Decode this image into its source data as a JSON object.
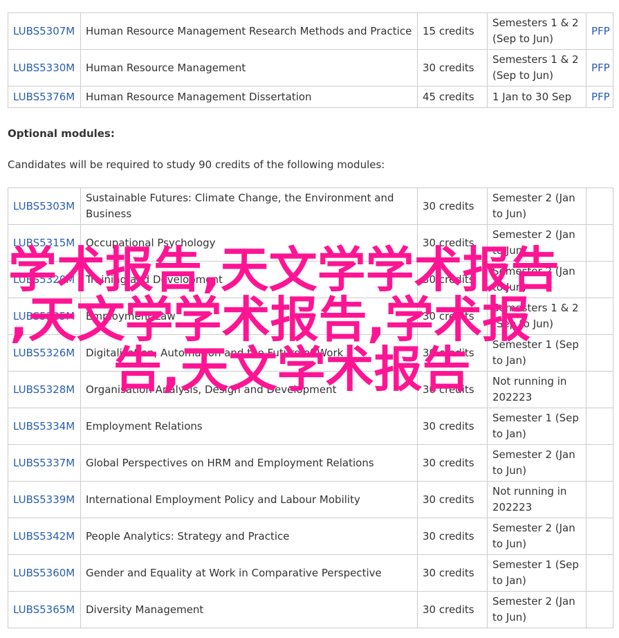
{
  "core_modules": [
    {
      "code": "LUBS5307M",
      "name": "Human Resource Management Research Methods and Practice",
      "credits": "15 credits",
      "semester_line1": "Semesters 1 & 2",
      "semester_line2": "(Sep to Jun)",
      "pfp": "PFP"
    },
    {
      "code": "LUBS5330M",
      "name": "Human Resource Management",
      "credits": "30 credits",
      "semester_line1": "Semesters 1 & 2",
      "semester_line2": "(Sep to Jun)",
      "pfp": "PFP"
    },
    {
      "code": "LUBS5376M",
      "name": "Human Resource Management Dissertation",
      "credits": "45 credits",
      "semester_line1": "1 Jan to 30 Sep",
      "semester_line2": "",
      "pfp": "PFP"
    }
  ],
  "optional_heading": "Optional modules:",
  "optional_intro": "Candidates will be required to study 90 credits of the following modules:",
  "optional_modules": [
    {
      "code": "LUBS5303M",
      "name_line1": "Sustainable Futures: Climate Change, the Environment and",
      "name_line2": "Business",
      "credits": "30 credits",
      "semester_line1": "Semester 2 (Jan",
      "semester_line2": "to Jun)"
    },
    {
      "code": "LUBS5315M",
      "name_line1": "Occupational Psychology",
      "name_line2": "",
      "credits": "30 credits",
      "semester_line1": "Semester 2 (Jan",
      "semester_line2": "to Jun)"
    },
    {
      "code": "LUBS5320M",
      "name_line1": "Training and Development",
      "name_line2": "",
      "credits": "30 credits",
      "semester_line1": "Semester 2 (Jan",
      "semester_line2": "to Jun)"
    },
    {
      "code": "LUBS5325M",
      "name_line1": "Employment Law",
      "name_line2": "",
      "credits": "30 credits",
      "semester_line1": "Semesters 1 & 2",
      "semester_line2": "(Sep to Jun)"
    },
    {
      "code": "LUBS5326M",
      "name_line1": "Digitalisation, Automation and the Future of Work",
      "name_line2": "",
      "credits": "30 credits",
      "semester_line1": "Semester 1 (Sep",
      "semester_line2": "to Jan)"
    },
    {
      "code": "LUBS5328M",
      "name_line1": "Organisation Analysis, Design and Development",
      "name_line2": "",
      "credits": "30 credits",
      "semester_line1": "Not running in",
      "semester_line2": "202223"
    },
    {
      "code": "LUBS5334M",
      "name_line1": "Employment Relations",
      "name_line2": "",
      "credits": "30 credits",
      "semester_line1": "Semester 1 (Sep",
      "semester_line2": "to Jan)"
    },
    {
      "code": "LUBS5337M",
      "name_line1": "Global Perspectives on HRM and Employment Relations",
      "name_line2": "",
      "credits": "30 credits",
      "semester_line1": "Semester 2 (Jan",
      "semester_line2": "to Jun)"
    },
    {
      "code": "LUBS5339M",
      "name_line1": "International Employment Policy and Labour Mobility",
      "name_line2": "",
      "credits": "30 credits",
      "semester_line1": "Not running in",
      "semester_line2": "202223"
    },
    {
      "code": "LUBS5342M",
      "name_line1": "People Analytics: Strategy and Practice",
      "name_line2": "",
      "credits": "30 credits",
      "semester_line1": "Semester 2 (Jan",
      "semester_line2": "to Jun)"
    },
    {
      "code": "LUBS5360M",
      "name_line1": "Gender and Equality at Work in Comparative Perspective",
      "name_line2": "",
      "credits": "30 credits",
      "semester_line1": "Semester 1 (Sep",
      "semester_line2": "to Jan)"
    },
    {
      "code": "LUBS5365M",
      "name_line1": "Diversity Management",
      "name_line2": "",
      "credits": "30 credits",
      "semester_line1": "Semester 2 (Jan",
      "semester_line2": "to Jun)"
    }
  ],
  "overlay": {
    "line1": "学术报告,天文学学术报告",
    "line2": ",天文学学术报告,学术报",
    "line3": "告,天文学术报告",
    "color": "#ff1493"
  },
  "colors": {
    "link": "#2a5db0",
    "border": "#cccccc",
    "text": "#333333"
  }
}
